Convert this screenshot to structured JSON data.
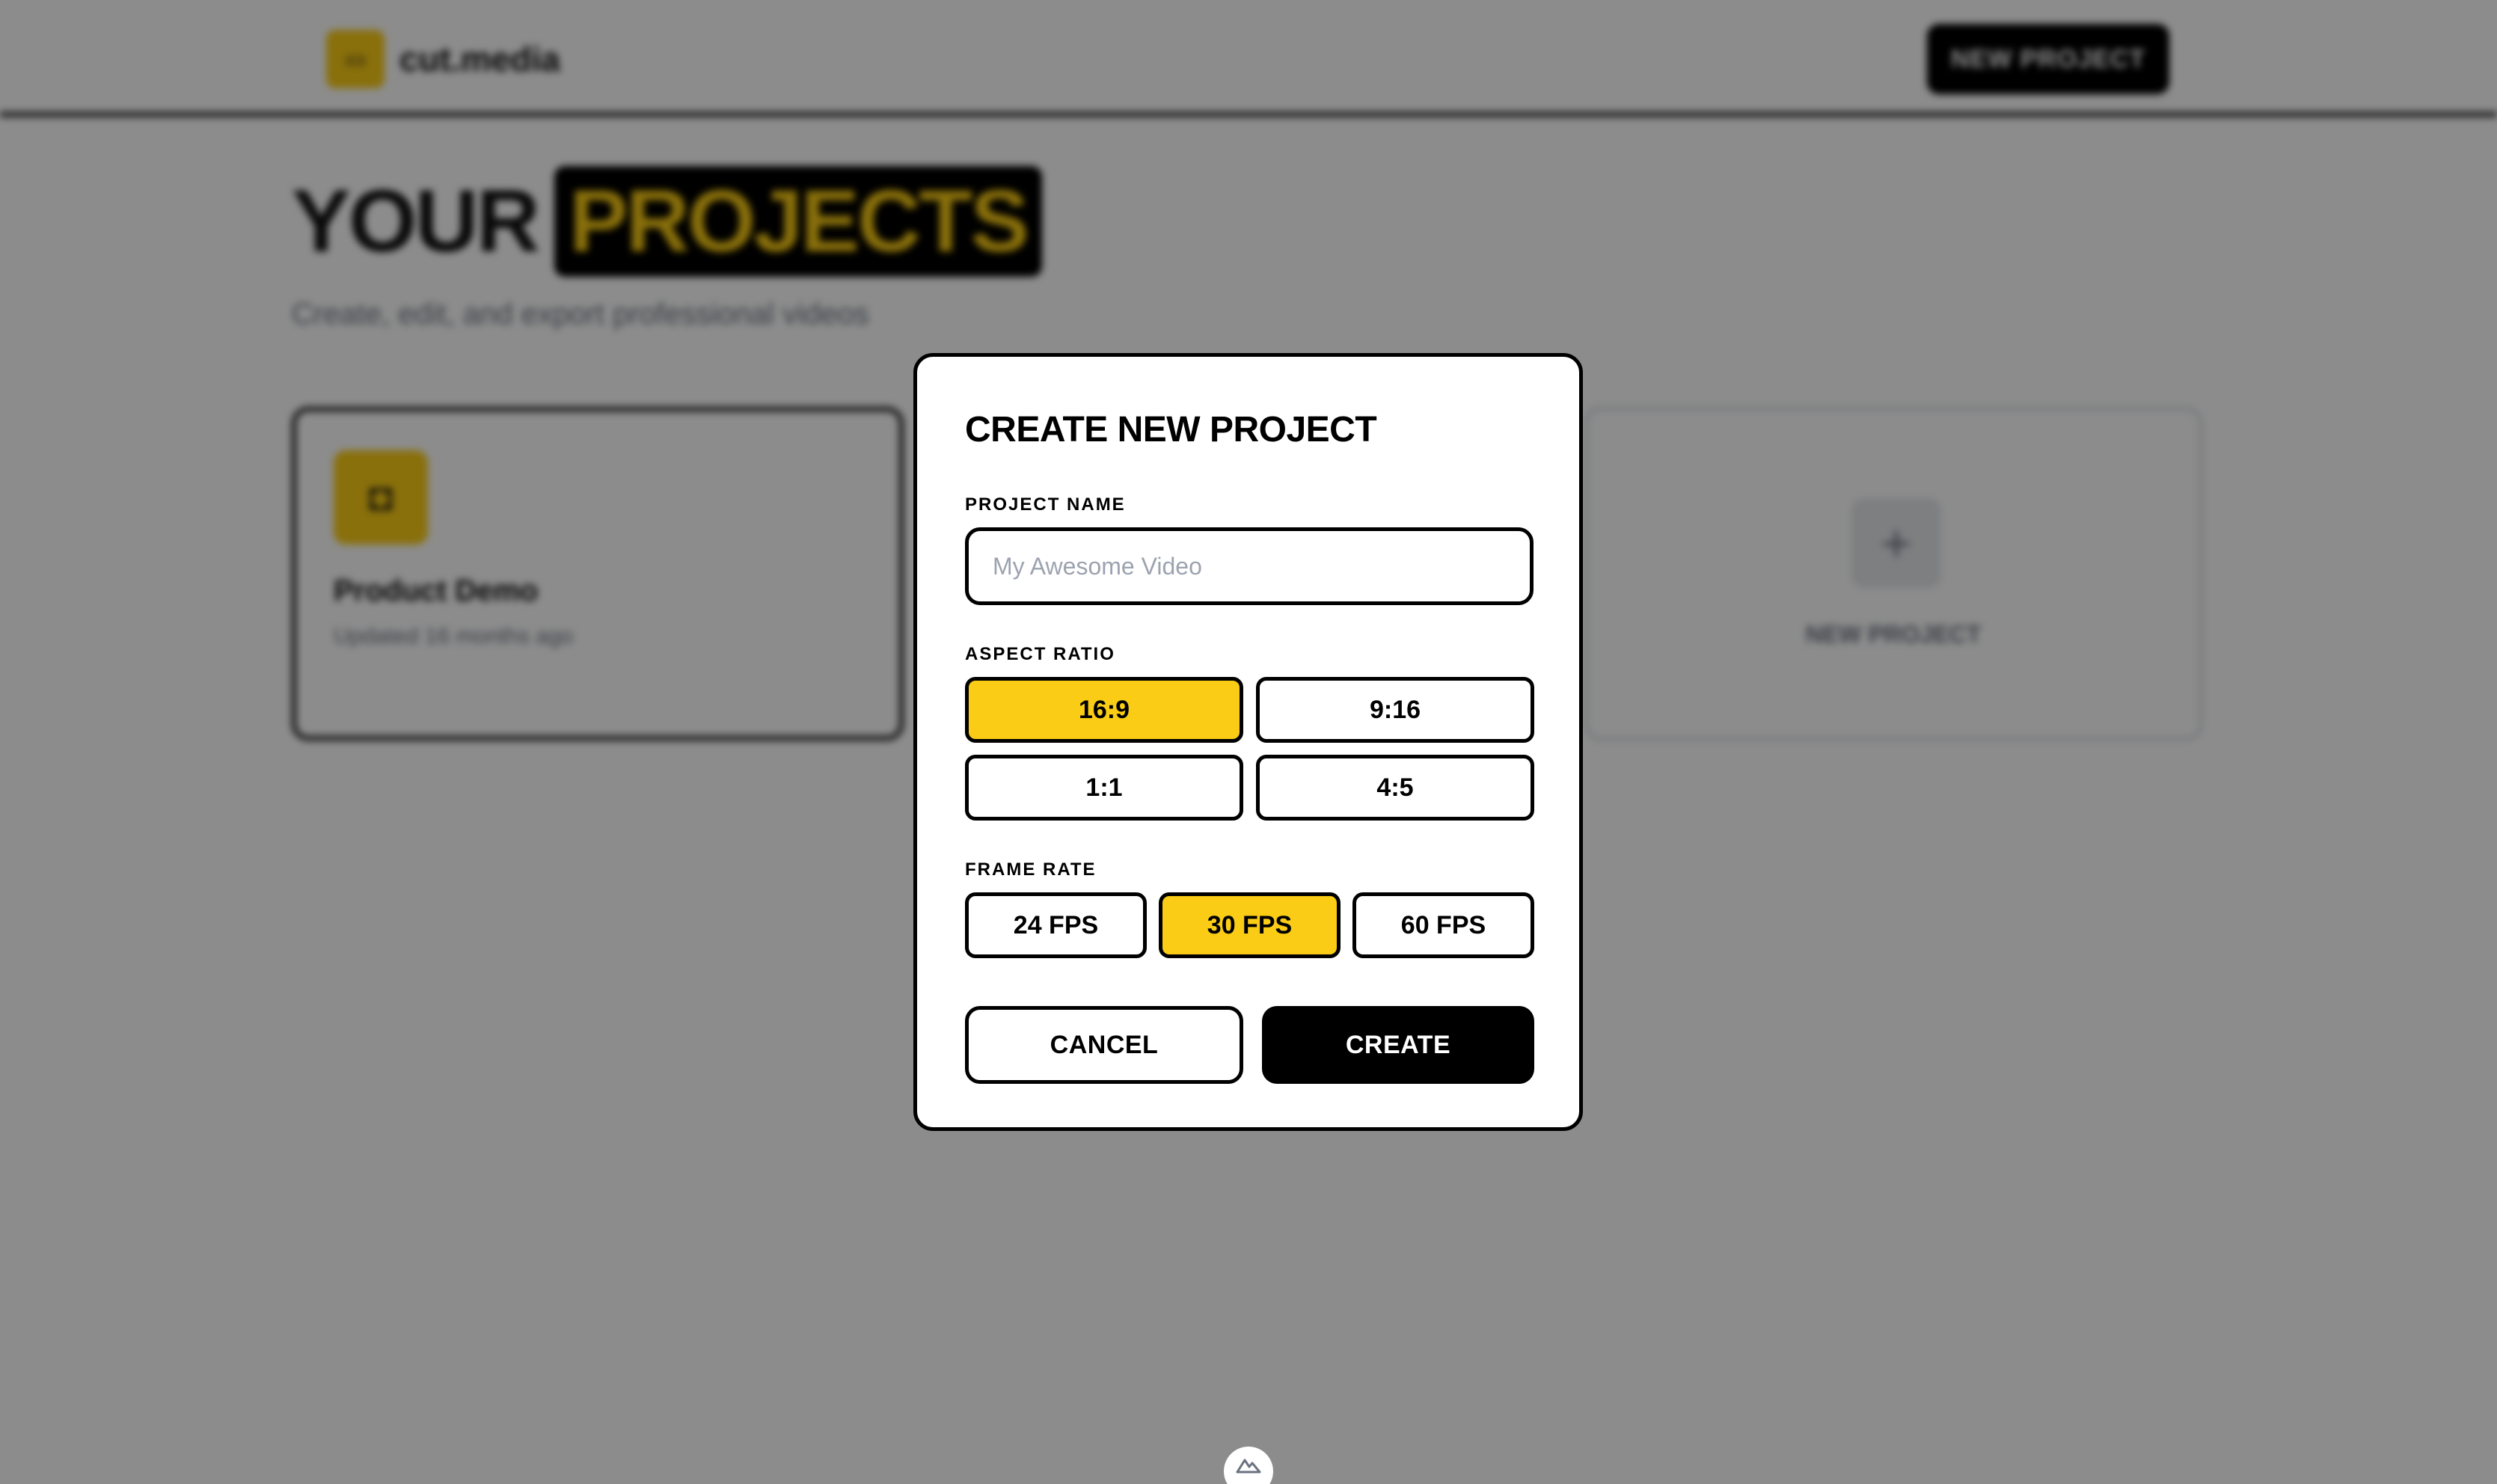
{
  "app": {
    "logo_text": "cut.media",
    "top_new_project": "NEW PROJECT"
  },
  "hero": {
    "title_plain": "YOUR",
    "title_highlight": "PROJECTS",
    "subtitle": "Create, edit, and export professional videos"
  },
  "projects": [
    {
      "name": "Product Demo",
      "updated": "Updated 16 months ago"
    }
  ],
  "new_card": {
    "label": "NEW PROJECT",
    "icon": "plus-icon"
  },
  "colors": {
    "accent": "#facc15",
    "text": "#000000",
    "overlay": "rgba(0,0,0,0.45)"
  },
  "modal": {
    "title": "CREATE NEW PROJECT",
    "project_name_label": "PROJECT NAME",
    "project_name_value": "",
    "project_name_placeholder": "My Awesome Video",
    "aspect_ratio_label": "ASPECT RATIO",
    "aspect_ratios": [
      "16:9",
      "9:16",
      "1:1",
      "4:5"
    ],
    "aspect_ratio_selected": "16:9",
    "frame_rate_label": "FRAME RATE",
    "frame_rates": [
      "24 FPS",
      "30 FPS",
      "60 FPS"
    ],
    "frame_rate_selected": "30 FPS",
    "cancel_label": "CANCEL",
    "create_label": "CREATE"
  }
}
